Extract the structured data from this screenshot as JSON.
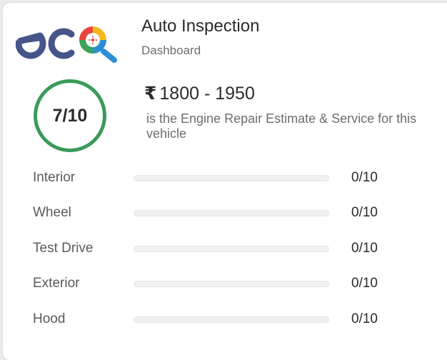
{
  "header": {
    "logo_text": "eco",
    "app_title": "Auto Inspection",
    "app_subtitle": "Dashboard"
  },
  "score": {
    "value": 7,
    "max": 10,
    "label": "7/10",
    "ring_color": "#3a9a5a"
  },
  "estimate": {
    "currency_symbol": "₹",
    "range": "1800 - 1950",
    "description": "is the Engine Repair Estimate & Service for this vehicle"
  },
  "categories": [
    {
      "label": "Interior",
      "score": "0/10",
      "value": 0
    },
    {
      "label": "Wheel",
      "score": "0/10",
      "value": 0
    },
    {
      "label": "Test Drive",
      "score": "0/10",
      "value": 0
    },
    {
      "label": "Exterior",
      "score": "0/10",
      "value": 0
    },
    {
      "label": "Hood",
      "score": "0/10",
      "value": 0
    }
  ],
  "colors": {
    "logo_text": "#46558a",
    "logo_red": "#e8463c",
    "logo_yellow": "#f5b81c",
    "logo_green": "#3ba35a",
    "logo_blue": "#2c8fd6",
    "logo_handle": "#2c8fd6"
  }
}
